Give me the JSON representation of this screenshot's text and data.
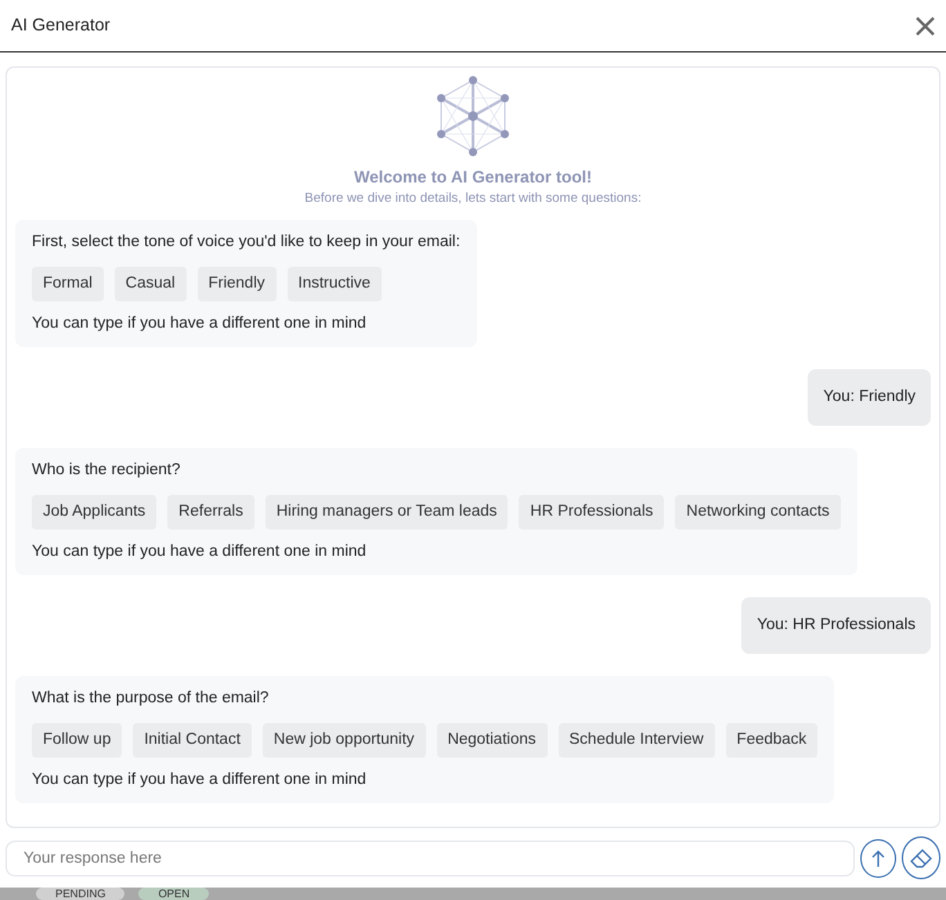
{
  "window": {
    "title": "AI Generator"
  },
  "welcome": {
    "title": "Welcome to AI Generator tool!",
    "subtitle": "Before we dive into details, lets start with some questions:"
  },
  "messages": [
    {
      "kind": "bot",
      "question": "First, select the tone of voice you'd like to keep in your email:",
      "options": [
        "Formal",
        "Casual",
        "Friendly",
        "Instructive"
      ],
      "hint": "You can type if you have a different one in mind"
    },
    {
      "kind": "user",
      "text": "You: Friendly"
    },
    {
      "kind": "bot",
      "question": "Who is the recipient?",
      "options": [
        "Job Applicants",
        "Referrals",
        "Hiring managers or Team leads",
        "HR Professionals",
        "Networking contacts"
      ],
      "hint": "You can type if you have a different one in mind"
    },
    {
      "kind": "user",
      "text": "You: HR Professionals"
    },
    {
      "kind": "bot",
      "question": "What is the purpose of the email?",
      "options": [
        "Follow up",
        "Initial Contact",
        "New job opportunity",
        "Negotiations",
        "Schedule Interview",
        "Feedback"
      ],
      "hint": "You can type if you have a different one in mind"
    }
  ],
  "input": {
    "placeholder": "Your response here"
  },
  "background_badges": [
    {
      "label": "PENDING",
      "color": "#d0d0d0"
    },
    {
      "label": "OPEN",
      "color": "#b9cdbf"
    }
  ]
}
